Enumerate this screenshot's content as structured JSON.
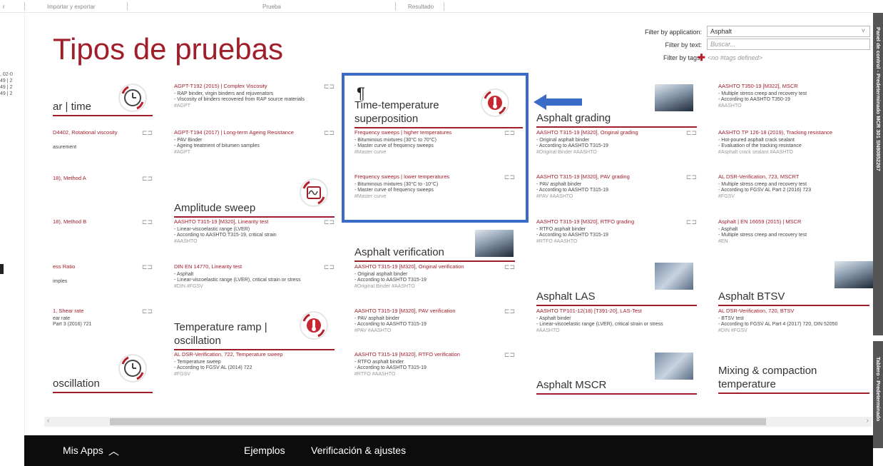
{
  "topbar": {
    "tab_left": "r",
    "tab1": "Importar y exportar",
    "tab2": "Prueba",
    "tab3": "Resultado"
  },
  "leftstrip": {
    "lines": [
      ", 02-0",
      "49 | 2",
      "49 | 2",
      "49 | 2"
    ]
  },
  "page_title": "Tipos de pruebas",
  "filters": {
    "application_label": "Filter by application:",
    "application_value": "Asphalt",
    "text_label": "Filter by text:",
    "text_placeholder": "Buscar...",
    "tags_label": "Filter by tags:",
    "tags_value": "<no #tags defined>"
  },
  "col1": {
    "section_top": "ar | time",
    "items": [
      {
        "title": "D4402, Rotational viscosity",
        "line": "asurement"
      },
      {
        "title": "18), Method A",
        "line": ""
      },
      {
        "title": "18), Method B",
        "line": ""
      },
      {
        "title": "ess Ratio",
        "line": "imples"
      },
      {
        "title": "1, Shear rate",
        "line": "ear rate",
        "line2": "Part 3 (2016) 721"
      }
    ],
    "section_bottom": "oscillation"
  },
  "col2": {
    "items_top": [
      {
        "title": "AGPT-T192 (2015) | Complex Viscosity",
        "lines": [
          "- RAP binder, virgin binders and rejuvenators",
          "- Viscosity of binders recovered from RAP source materials"
        ],
        "tags": "#AGPT"
      },
      {
        "title": "AGPT-T194 (2017) | Long-term Ageing Resistance",
        "lines": [
          "- PAV Binder",
          "- Ageing treatment of bitumen samples"
        ],
        "tags": "#AGPT"
      }
    ],
    "section_amplitude": "Amplitude sweep",
    "items_amp": [
      {
        "title": "AASHTO T315-19 [M320], Linearity test",
        "lines": [
          "- Linear-viscoelastic range (LVER)",
          "- According to AASHTO T315-19, critical strain"
        ],
        "tags": "#AASHTO"
      },
      {
        "title": "DIN EN 14770, Linearity test",
        "lines": [
          "- Asphalt",
          "- Linear-viscoelastic range (LVER), critical strain or stress"
        ],
        "tags": "#DIN  #FGSV"
      }
    ],
    "section_temp_ramp_1": "Temperature ramp |",
    "section_temp_ramp_2": "oscillation",
    "items_ramp": [
      {
        "title": "AL DSR-Verification, 722, Temperature sweep",
        "lines": [
          "- Temperature sweep",
          "- According to FGSV AL (2014) 722"
        ],
        "tags": "#FGSV"
      }
    ]
  },
  "col3": {
    "cursor_glyph": "¶",
    "section_tts_1": "Time-temperature",
    "section_tts_2": "superposition",
    "items_tts": [
      {
        "title": "Frequency sweeps | higher temperatures",
        "lines": [
          "- Bituminous mixtures (30°C to 70°C)",
          "- Master curve of frequency sweeps"
        ],
        "tags": "#Master curve"
      },
      {
        "title": "Frequency sweeps | lower temperatures",
        "lines": [
          "- Bituminous mixtures (30°C to -10°C)",
          "- Master curve of frequency sweeps"
        ],
        "tags": "#Master curve"
      }
    ],
    "section_verif": "Asphalt verification",
    "items_verif": [
      {
        "title": "AASHTO T315-19 [M320], Original verification",
        "lines": [
          "- Original asphalt binder",
          "- According to AASHTO T315-19"
        ],
        "tags": "#Original Binder  #AASHTO"
      },
      {
        "title": "AASHTO T315-19 [M320], PAV verification",
        "lines": [
          "- PAV asphalt binder",
          "- According to AASHTO T315-19"
        ],
        "tags": "#PAV  #AASHTO"
      },
      {
        "title": "AASHTO T315-19 [M320], RTFO verification",
        "lines": [
          "- RTFO asphalt binder",
          "- According to AASHTO T315-19"
        ],
        "tags": "#RTFO  #AASHTO"
      }
    ]
  },
  "col4": {
    "section_grading": "Asphalt grading",
    "items_grading": [
      {
        "title": "AASHTO T315-19 [M320], Original grading",
        "lines": [
          "- Original asphalt binder",
          "- According to AASHTO T315-19"
        ],
        "tags": "#Original Binder  #AASHTO"
      },
      {
        "title": "AASHTO T315-19 [M320], PAV grading",
        "lines": [
          "- PAV asphalt binder",
          "- According to AASHTO T315-19"
        ],
        "tags": "#PAV  #AASHTO"
      },
      {
        "title": "AASHTO T315-19 [M320], RTFO grading",
        "lines": [
          "- RTFO asphalt binder",
          "- According to AASHTO T315-19"
        ],
        "tags": "#RTFO  #AASHTO"
      }
    ],
    "section_las": "Asphalt LAS",
    "items_las": [
      {
        "title": "AASHTO TP101-12(18) [T391-20], LAS-Test",
        "lines": [
          "- Asphalt binder",
          "- Linear-viscoelastic range (LVER), critical strain or stress"
        ],
        "tags": "#AASHTO"
      }
    ],
    "section_mscr": "Asphalt MSCR"
  },
  "col5": {
    "items_top": [
      {
        "title": "AASHTO T350-19 [M322], MSCR",
        "lines": [
          "- Multiple stress creep and recovery test",
          "- According to AASHTO T350-19"
        ],
        "tags": "#AASHTO"
      },
      {
        "title": "AASHTO TP 126-18 (2019), Tracking resistance",
        "lines": [
          "- Hot-poured asphalt crack sealant",
          "- Evaluation of the tracking resistance"
        ],
        "tags": "#Asphalt crack sealant  #AASHTO"
      },
      {
        "title": "AL DSR-Verification, 723, MSCRT",
        "lines": [
          "- Multiple stress creep and recovery test",
          "- According to FGSV AL Part 2 (2016) 723"
        ],
        "tags": "#FGSV"
      },
      {
        "title": "Asphalt | EN 16659 (2015) | MSCR",
        "lines": [
          "- Asphalt",
          "- Multiple stress creep and recovery test"
        ],
        "tags": "#EN"
      }
    ],
    "section_btsv": "Asphalt BTSV",
    "items_btsv": [
      {
        "title": "AL DSR-Verification, 720, BTSV",
        "lines": [
          "- BTSV test",
          "- According to FGSV AL Part 4 (2017) 720, DIN 52050"
        ],
        "tags": "#DIN  #FGSV"
      }
    ],
    "section_mixing_1": "Mixing & compaction",
    "section_mixing_2": "temperature"
  },
  "right_panel": {
    "top_text": "Panel de control - Predeterminado MCR 301 SN80852267",
    "bottom_text": "Tablero - Predeterminado"
  },
  "bottombar": {
    "apps": "Mis Apps",
    "examples": "Ejemplos",
    "verification": "Verificación & ajustes"
  },
  "colors": {
    "accent": "#a01e2a",
    "highlight": "#3a6bc9"
  }
}
